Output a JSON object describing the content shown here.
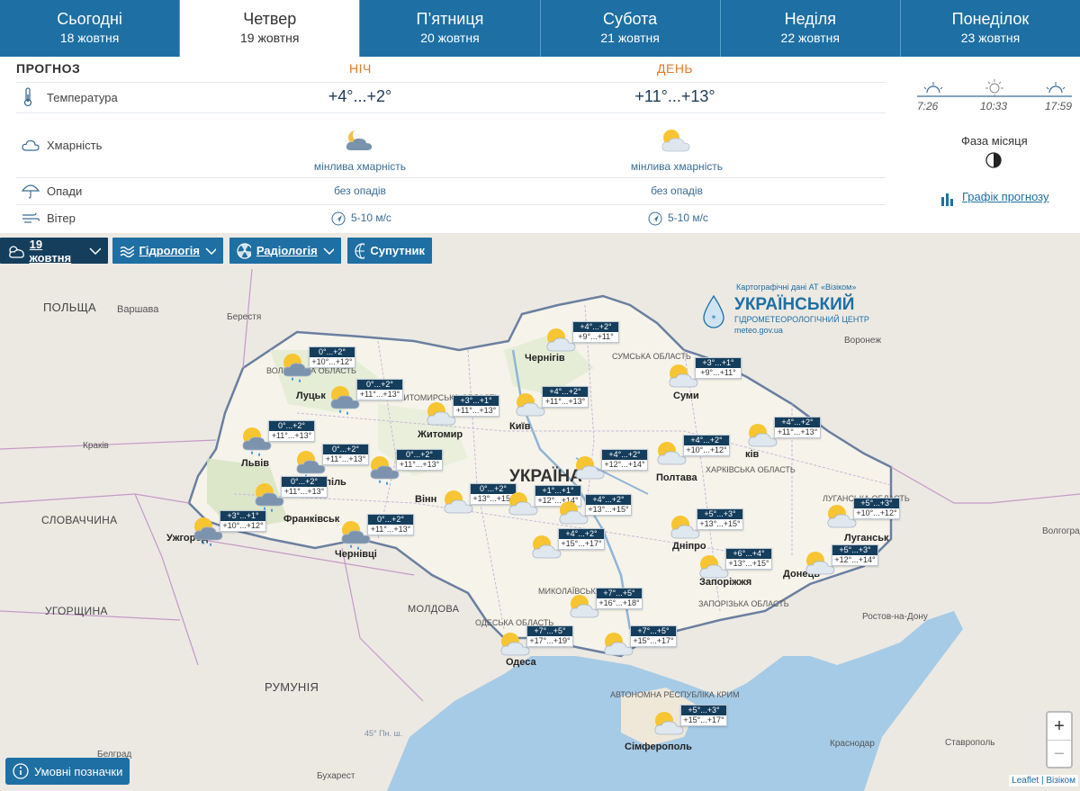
{
  "tabs": [
    {
      "day": "Сьогодні",
      "date": "18 жовтня"
    },
    {
      "day": "Четвер",
      "date": "19 жовтня"
    },
    {
      "day": "П’ятниця",
      "date": "20 жовтня"
    },
    {
      "day": "Субота",
      "date": "21 жовтня"
    },
    {
      "day": "Неділя",
      "date": "22 жовтня"
    },
    {
      "day": "Понеділок",
      "date": "23 жовтня"
    }
  ],
  "forecast": {
    "title": "ПРОГНОЗ",
    "night_header": "НІЧ",
    "day_header": "ДЕНЬ",
    "temperature": {
      "label": "Температура",
      "night": "+4°...+2°",
      "day": "+11°...+13°"
    },
    "clouds": {
      "label": "Хмарність",
      "night": "мінлива хмарність",
      "day": "мінлива хмарність"
    },
    "precip": {
      "label": "Опади",
      "night": "без опадів",
      "day": "без опадів"
    },
    "wind": {
      "label": "Вітер",
      "night": "5-10 м/с",
      "day": "5-10 м/с"
    },
    "sunrise": "7:26",
    "noon": "10:33",
    "sunset": "17:59",
    "moon_label": "Фаза місяця",
    "graph_link": "Графік прогнозу"
  },
  "map_controls": {
    "date": "19 жовтня",
    "hydrology": "Гідрологія",
    "radiology": "Радіологія",
    "satellite": "Супутник"
  },
  "logo": {
    "credit": "Картографічні дані АТ «Візіком»",
    "line1": "УКРАЇНСЬКИЙ",
    "line2": "ГІДРОМЕТЕОРОЛОГІЧНИЙ ЦЕНТР",
    "url": "meteo.gov.ua"
  },
  "legend_button": "Умовні позначки",
  "attribution": "Leaflet | Візіком",
  "zoom": {
    "in": "+",
    "out": "−"
  },
  "countries": {
    "poland": "ПОЛЬЩА",
    "slovakia": "СЛОВАЧЧИНА",
    "hungary": "УГОРЩИНА",
    "romania": "РУМУНІЯ",
    "moldova": "МОЛДОВА",
    "ukraine": "УКРАЇНА"
  },
  "places": {
    "warsaw": "Варшава",
    "brest": "Берестя",
    "krakow": "Краків",
    "bucharest": "Бухарест",
    "belgrade": "Белград",
    "voronezh": "Воронеж",
    "volgograd": "Волгоград",
    "rostov": "Ростов-на-Дону",
    "krasnodar": "Краснодар",
    "stavropol": "Ставрополь",
    "chernihiv": "Чернігів",
    "sumy": "Суми",
    "kyiv": "Київ",
    "zhytomyr": "Житомир",
    "lutsk": "Луцьк",
    "lviv": "Львів",
    "ternopil": "Тернопіль",
    "ivano": "Франківськ",
    "uzhhorod": "Ужгород",
    "chernivtsi": "Чернівці",
    "vinnytsia": "Вінн",
    "poltava": "Полтава",
    "kharkiv": "ків",
    "dnipro": "Дніпро",
    "zaporizhzhia": "Запоріжжя",
    "donetsk": "Донець",
    "luhansk": "Луганськ",
    "odesa": "Одеса",
    "simferopol": "Сімферополь",
    "sumy_obl": "СУМСЬКА ОБЛАСТЬ",
    "kharkiv_obl": "ХАРКІВСЬКА ОБЛАСТЬ",
    "luhansk_obl": "ЛУГАНСЬКА ОБЛАСТЬ",
    "zaporizhzhia_obl": "ЗАПОРІЗЬКА ОБЛАСТЬ",
    "odesa_obl": "ОДЕСЬКА ОБЛАСТЬ",
    "mykolaiv_obl": "МИКОЛАЇВСЬКА ОБЛАСТЬ",
    "crimea": "АВТОНОМНА РЕСПУБЛІКА КРИМ",
    "zhytomyr_obl": "ЖИТОМИРСЬКА ОБЛАСТЬ",
    "volyn_obl": "ВОЛИНСЬКА ОБЛАСТЬ",
    "parallel": "45° Пн. ш."
  },
  "stations": [
    {
      "id": "chernihiv",
      "night": "+4°...+2°",
      "day": "+9°...+11°",
      "rain": false
    },
    {
      "id": "sumy",
      "night": "+3°...+1°",
      "day": "+9°...+11°",
      "rain": false
    },
    {
      "id": "volyn",
      "night": "0°...+2°",
      "day": "+10°...+12°",
      "rain": true
    },
    {
      "id": "rivne",
      "night": "0°...+2°",
      "day": "+11°...+13°",
      "rain": true
    },
    {
      "id": "zhytomyr",
      "night": "+3°...+1°",
      "day": "+11°...+13°",
      "rain": false
    },
    {
      "id": "kyiv",
      "night": "+4°...+2°",
      "day": "+11°...+13°",
      "rain": false
    },
    {
      "id": "kharkiv",
      "night": "+4°...+2°",
      "day": "+11°...+13°",
      "rain": false
    },
    {
      "id": "lviv",
      "night": "0°...+2°",
      "day": "+11°...+13°",
      "rain": true
    },
    {
      "id": "ternopil",
      "night": "0°...+2°",
      "day": "+11°...+13°",
      "rain": true
    },
    {
      "id": "khmelnytskyi",
      "night": "0°...+2°",
      "day": "+11°...+13°",
      "rain": true
    },
    {
      "id": "poltava",
      "night": "+4°...+2°",
      "day": "+10°...+12°",
      "rain": false
    },
    {
      "id": "cherkasy",
      "night": "+4°...+2°",
      "day": "+12°...+14°",
      "rain": false
    },
    {
      "id": "ivano",
      "night": "0°...+2°",
      "day": "+11°...+13°",
      "rain": true
    },
    {
      "id": "vinnytsia",
      "night": "0°...+2°",
      "day": "+13°...+15°",
      "rain": false
    },
    {
      "id": "kirovohrad",
      "night": "+1°...+1°",
      "day": "+12°...+14°",
      "rain": false
    },
    {
      "id": "kropyvnytskyi",
      "night": "+4°...+2°",
      "day": "+13°...+15°",
      "rain": false
    },
    {
      "id": "uzhhorod",
      "night": "+3°...+1°",
      "day": "+10°...+12°",
      "rain": true
    },
    {
      "id": "chernivtsi",
      "night": "0°...+2°",
      "day": "+11°...+13°",
      "rain": true
    },
    {
      "id": "dnipro",
      "night": "+5°...+3°",
      "day": "+13°...+15°",
      "rain": false
    },
    {
      "id": "luhansk",
      "night": "+5°...+3°",
      "day": "+10°...+12°",
      "rain": false
    },
    {
      "id": "kirov2",
      "night": "+4°...+2°",
      "day": "+15°...+17°",
      "rain": false
    },
    {
      "id": "zaporizhzhia",
      "night": "+6°...+4°",
      "day": "+13°...+15°",
      "rain": false
    },
    {
      "id": "donetsk",
      "night": "+5°...+3°",
      "day": "+12°...+14°",
      "rain": false
    },
    {
      "id": "mykolaiv",
      "night": "+7°...+5°",
      "day": "+16°...+18°",
      "rain": false
    },
    {
      "id": "odesa",
      "night": "+7°...+5°",
      "day": "+17°...+19°",
      "rain": false
    },
    {
      "id": "kherson",
      "night": "+7°...+5°",
      "day": "+15°...+17°",
      "rain": false
    },
    {
      "id": "crimea",
      "night": "+5°...+3°",
      "day": "+15°...+17°",
      "rain": false
    }
  ]
}
